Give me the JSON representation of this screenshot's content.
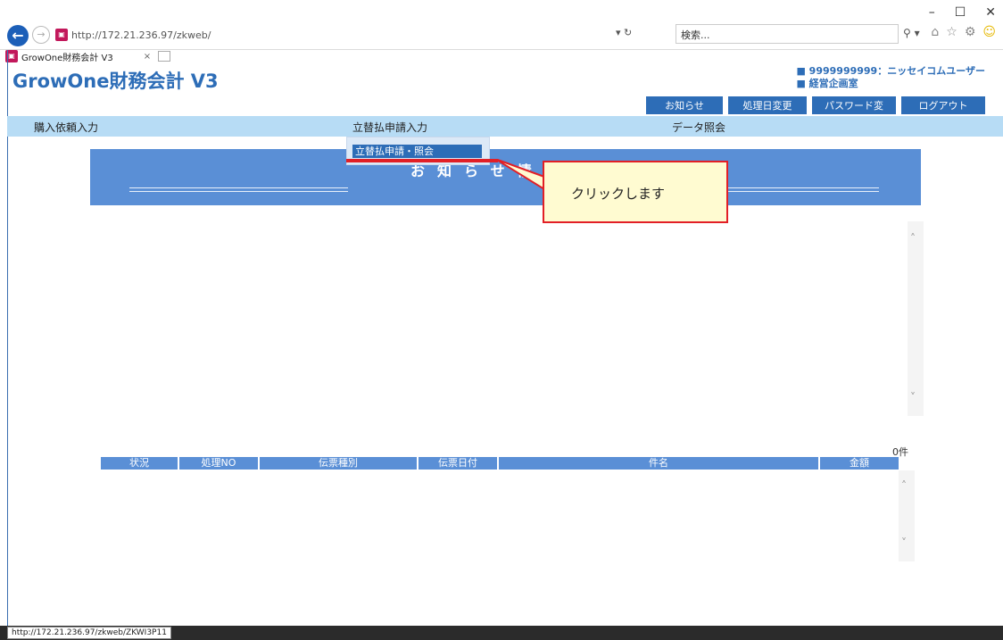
{
  "browser": {
    "url": "http://172.21.236.97/zkweb/",
    "search_placeholder": "検索...",
    "tab_title": "GrowOne財務会計 V3",
    "status_url": "http://172.21.236.97/zkweb/ZKWI3P11"
  },
  "app": {
    "title": "GrowOne財務会計 V3",
    "user_line": "■ 9999999999：ニッセイコムユーザー",
    "dept_line": "■ 経営企画室"
  },
  "header_buttons": {
    "notice": "お知らせ",
    "date_change": "処理日変更",
    "password_change": "パスワード変更",
    "logout": "ログアウト"
  },
  "nav": {
    "purchase": "購入依頼入力",
    "advance": "立替払申請入力",
    "data_query": "データ照会"
  },
  "dropdown": {
    "item1": "立替払申請・照会"
  },
  "notice_panel": {
    "title": "お知らせ情報"
  },
  "callout": {
    "text": "クリックします"
  },
  "table": {
    "count": "0件",
    "columns": [
      "状況",
      "処理NO",
      "伝票種別",
      "伝票日付",
      "件名",
      "金額"
    ]
  },
  "colors": {
    "accent": "#2d6db7",
    "nav_bg": "#b7dcf5",
    "panel_bg": "#5a8fd6",
    "callout_border": "#e21f26",
    "callout_bg": "#fffbd1"
  }
}
